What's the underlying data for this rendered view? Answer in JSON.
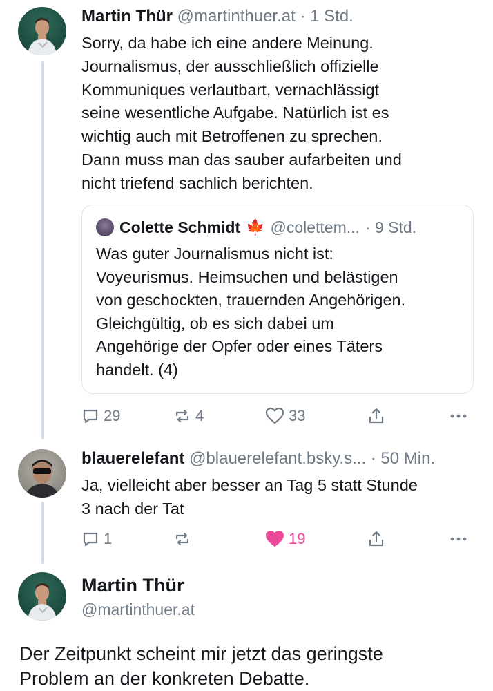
{
  "post1": {
    "author": "Martin Thür",
    "handle": "@martinthuer.at",
    "time": "· 1 Std.",
    "lines": [
      "Sorry, da habe ich eine andere Meinung.",
      "Journalismus, der ausschließlich offizielle",
      "Kommuniques verlautbart, vernachlässigt",
      "seine wesentliche Aufgabe. Natürlich ist es",
      "wichtig auch mit Betroffenen zu sprechen.",
      "Dann muss man das sauber aufarbeiten und",
      "nicht triefend sachlich berichten."
    ],
    "quote": {
      "author": "Colette Schmidt",
      "emoji": "🍁",
      "handle": "@colettem...",
      "time": "· 9 Std.",
      "lines": [
        "Was guter Journalismus nicht ist:",
        "Voyeurismus. Heimsuchen und belästigen",
        "von geschockten, trauernden Angehörigen.",
        "Gleichgültig, ob es sich dabei um",
        "Angehörige der Opfer oder eines Täters",
        "handelt.  (4)"
      ]
    },
    "replies": "29",
    "reposts": "4",
    "likes": "33"
  },
  "post2": {
    "author": "blauerelefant",
    "handle": "@blauerelefant.bsky.s...",
    "time": "· 50 Min.",
    "lines": [
      "Ja, vielleicht aber besser an Tag 5 statt Stunde",
      "3 nach der Tat"
    ],
    "replies": "1",
    "reposts": "",
    "likes": "19",
    "liked": true
  },
  "post3": {
    "author": "Martin Thür",
    "handle": "@martinthuer.at",
    "lines": [
      "Der Zeitpunkt scheint mir jetzt das geringste",
      "Problem an der konkreten Debatte."
    ]
  },
  "colors": {
    "accent_like": "#ec4899",
    "muted": "#6f7a86",
    "thread_line": "#d6dde4"
  },
  "icons": [
    "reply-icon",
    "repost-icon",
    "like-icon",
    "share-icon",
    "more-icon"
  ]
}
